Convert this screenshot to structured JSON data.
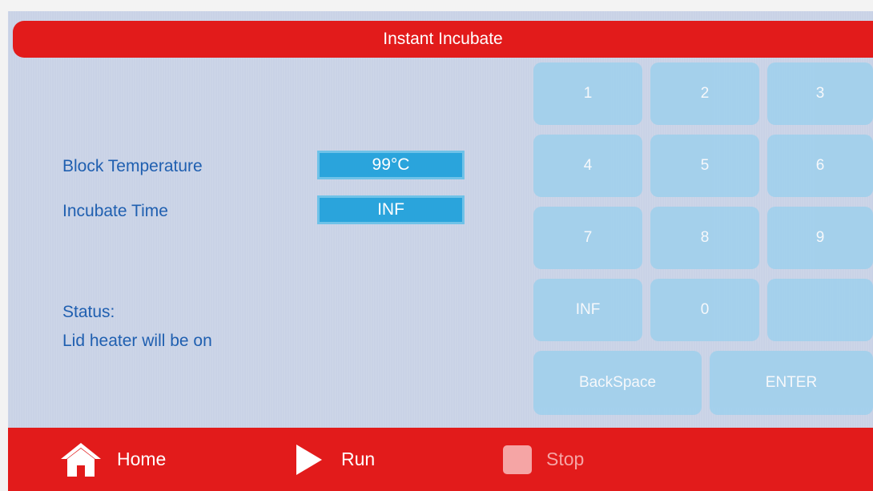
{
  "title": "Instant Incubate",
  "fields": [
    {
      "label": "Block Temperature",
      "value": "99°C"
    },
    {
      "label": "Incubate Time",
      "value": "INF"
    }
  ],
  "status": {
    "label": "Status:",
    "message": "Lid heater will be on"
  },
  "keypad": {
    "k1": "1",
    "k2": "2",
    "k3": "3",
    "k4": "4",
    "k5": "5",
    "k6": "6",
    "k7": "7",
    "k8": "8",
    "k9": "9",
    "inf": "INF",
    "k0": "0",
    "blank": "",
    "backspace": "BackSpace",
    "enter": "ENTER"
  },
  "bottom": {
    "home": "Home",
    "run": "Run",
    "stop": "Stop"
  },
  "colors": {
    "bar_red": "#e21b1b",
    "screen_bg": "#c9d2e6",
    "label_blue": "#1f5fb0",
    "value_blue": "#2aa4dc",
    "key_disabled": "#9ed0ec",
    "stop_disabled": "#f5a5a5"
  },
  "icons": {
    "home": "home-icon",
    "run": "play-icon",
    "stop": "stop-square-icon"
  }
}
